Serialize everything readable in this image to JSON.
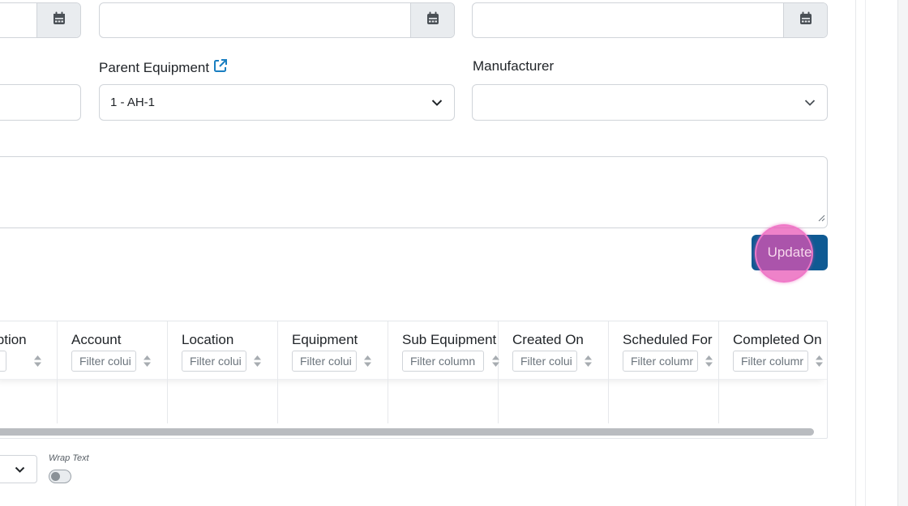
{
  "form": {
    "parent_equipment": {
      "label": "Parent Equipment",
      "value": "1 - AH-1"
    },
    "manufacturer": {
      "label": "Manufacturer",
      "value": ""
    },
    "update_button_label": "Update"
  },
  "grid": {
    "columns": [
      {
        "title": "iption",
        "filter_placeholder": "olui"
      },
      {
        "title": "Account",
        "filter_placeholder": "Filter colui"
      },
      {
        "title": "Location",
        "filter_placeholder": "Filter colui"
      },
      {
        "title": "Equipment",
        "filter_placeholder": "Filter colui"
      },
      {
        "title": "Sub Equipment",
        "filter_placeholder": "Filter column"
      },
      {
        "title": "Created On",
        "filter_placeholder": "Filter colui"
      },
      {
        "title": "Scheduled For",
        "filter_placeholder": "Filter columr"
      },
      {
        "title": "Completed On",
        "filter_placeholder": "Filter columr"
      }
    ],
    "wrap_text_label": "Wrap Text",
    "wrap_text_enabled": false
  },
  "colors": {
    "primary_button": "#0f5a93",
    "link_icon": "#1a7fc1",
    "click_highlight": "#e852b4"
  },
  "icons": {
    "date_picker": "calendar-icon",
    "dropdown": "chevron-down-icon",
    "external_link": "external-link-icon",
    "sort": "sort-icon"
  }
}
